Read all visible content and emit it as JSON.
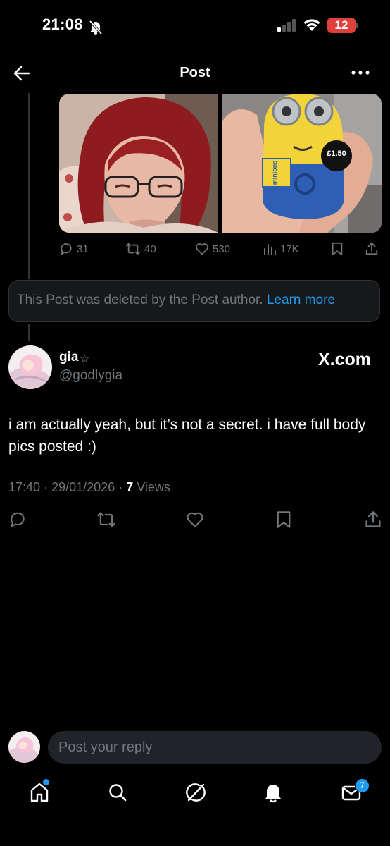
{
  "status_bar": {
    "time": "21:08",
    "battery": "12"
  },
  "header": {
    "title": "Post"
  },
  "quoted_post": {
    "replies": "31",
    "reposts": "40",
    "likes": "530",
    "views": "17K",
    "price_tag": "£1.50",
    "product_label": "minions"
  },
  "deleted_notice": {
    "text": "This Post was deleted by the Post author.",
    "link": "Learn more"
  },
  "post": {
    "author_name": "gia",
    "author_badge": "☆",
    "handle": "@godlygia",
    "watermark": "X.com",
    "text": "i am actually yeah, but it’s not a secret. i have full body pics posted :)",
    "time": "17:40",
    "date": "29/01/2026",
    "views_count": "7",
    "views_label": "Views",
    "separator": "·"
  },
  "reply_bar": {
    "placeholder": "Post your reply"
  },
  "tab_bar": {
    "messages_badge": "7"
  },
  "colors": {
    "accent": "#1d9bf0",
    "muted": "#71767b",
    "background": "#000000"
  }
}
